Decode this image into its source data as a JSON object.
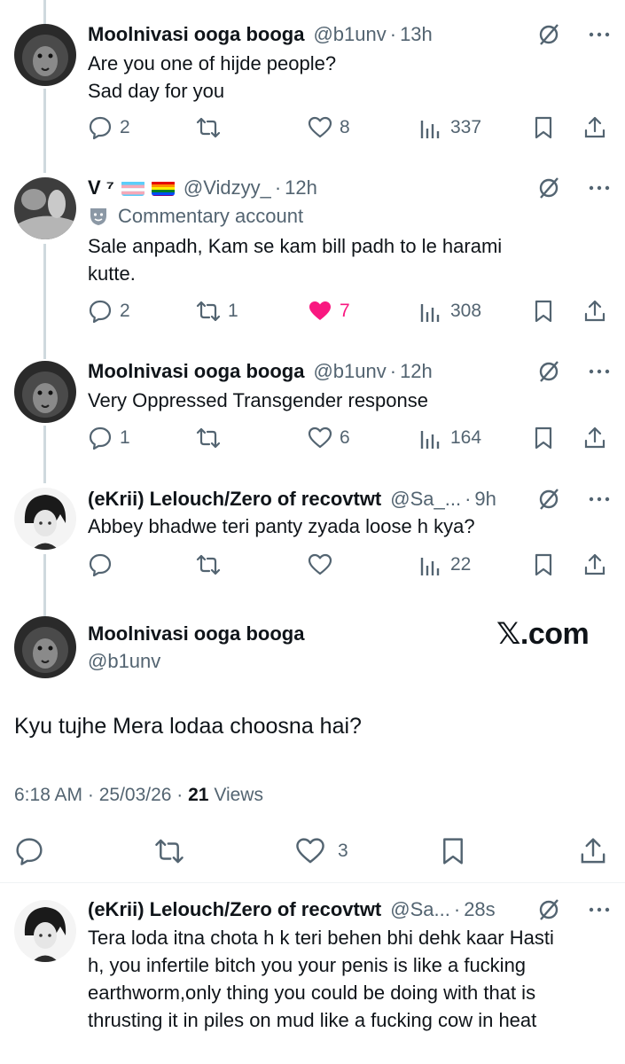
{
  "tweets": [
    {
      "name": "Moolnivasi ooga booga",
      "handle": "@b1unv",
      "sep": "·",
      "time": "13h",
      "lines": [
        "Are you one of hijde people?",
        "Sad day for you"
      ],
      "replies": "2",
      "reposts": "",
      "likes": "8",
      "views": "337"
    },
    {
      "name": "V ⁷",
      "handle": "@Vidzyy_",
      "sep": "·",
      "time": "12h",
      "commentary": "Commentary account",
      "lines": [
        "Sale anpadh, Kam se kam bill padh to le harami",
        "kutte."
      ],
      "replies": "2",
      "reposts": "1",
      "likes": "7",
      "views": "308"
    },
    {
      "name": "Moolnivasi ooga booga",
      "handle": "@b1unv",
      "sep": "·",
      "time": "12h",
      "lines": [
        "Very Oppressed Transgender response"
      ],
      "replies": "1",
      "reposts": "",
      "likes": "6",
      "views": "164"
    },
    {
      "name": "(eKrii) Lelouch/Zero of recovtwt",
      "handle": "@Sa_...",
      "sep": "·",
      "time": "9h",
      "lines": [
        "Abbey bhadwe teri panty zyada loose h kya?"
      ],
      "replies": "",
      "reposts": "",
      "likes": "",
      "views": "22"
    }
  ],
  "main": {
    "name": "Moolnivasi ooga booga",
    "handle": "@b1unv",
    "brand": "𝕏.com",
    "text": "Kyu tujhe Mera lodaa choosna hai?",
    "timestamp": "6:18 AM · 25/03/26 · ",
    "views_count": "21",
    "views_label": " Views",
    "likes": "3"
  },
  "reply": {
    "name": "(eKrii) Lelouch/Zero of recovtwt",
    "handle": "@Sa...",
    "sep": "·",
    "time": "28s",
    "lines": [
      "Tera loda itna chota h k teri behen bhi dehk kaar Hasti",
      "h, you infertile bitch you your penis is like a fucking",
      "earthworm,only thing you could be doing with that is",
      "thrusting it in piles on mud like a fucking cow in heat"
    ]
  },
  "colors": {
    "text": "#0f1419",
    "muted": "#536471",
    "like_pink": "#f91880",
    "thread_line": "#cfd9de"
  }
}
